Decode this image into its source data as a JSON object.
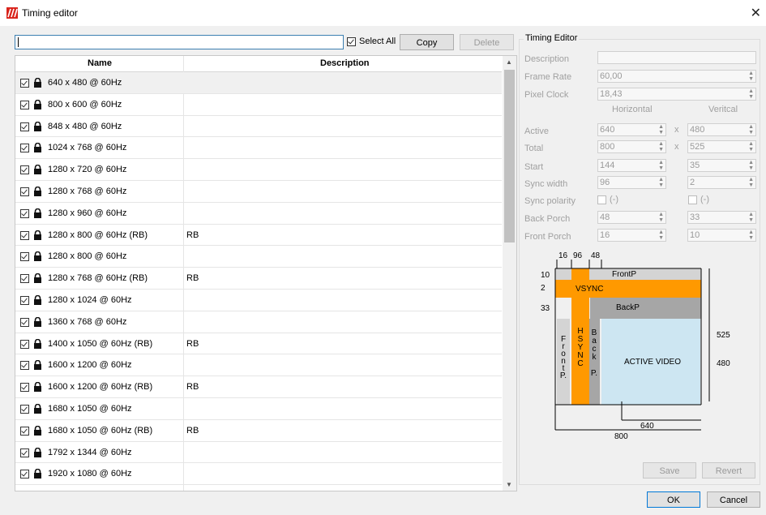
{
  "window": {
    "title": "Timing editor"
  },
  "toolbar": {
    "search_value": "",
    "select_all_label": "Select All",
    "select_all_checked": true,
    "copy_label": "Copy",
    "delete_label": "Delete"
  },
  "table": {
    "columns": [
      "Name",
      "Description"
    ],
    "rows": [
      {
        "name": "640 x 480 @ 60Hz",
        "desc": "",
        "checked": true,
        "locked": true,
        "selected": true
      },
      {
        "name": "800 x 600 @ 60Hz",
        "desc": "",
        "checked": true,
        "locked": true
      },
      {
        "name": "848 x 480 @ 60Hz",
        "desc": "",
        "checked": true,
        "locked": true
      },
      {
        "name": "1024 x 768 @ 60Hz",
        "desc": "",
        "checked": true,
        "locked": true
      },
      {
        "name": "1280 x 720 @ 60Hz",
        "desc": "",
        "checked": true,
        "locked": true
      },
      {
        "name": "1280 x 768 @ 60Hz",
        "desc": "",
        "checked": true,
        "locked": true
      },
      {
        "name": "1280 x 960 @ 60Hz",
        "desc": "",
        "checked": true,
        "locked": true
      },
      {
        "name": "1280 x 800 @ 60Hz (RB)",
        "desc": "RB",
        "checked": true,
        "locked": true
      },
      {
        "name": "1280 x 800 @ 60Hz",
        "desc": "",
        "checked": true,
        "locked": true
      },
      {
        "name": "1280 x 768 @ 60Hz (RB)",
        "desc": "RB",
        "checked": true,
        "locked": true
      },
      {
        "name": "1280 x 1024 @ 60Hz",
        "desc": "",
        "checked": true,
        "locked": true
      },
      {
        "name": "1360 x 768 @ 60Hz",
        "desc": "",
        "checked": true,
        "locked": true
      },
      {
        "name": "1400 x 1050 @ 60Hz (RB)",
        "desc": "RB",
        "checked": true,
        "locked": true
      },
      {
        "name": "1600 x 1200 @ 60Hz",
        "desc": "",
        "checked": true,
        "locked": true
      },
      {
        "name": "1600 x 1200 @ 60Hz (RB)",
        "desc": "RB",
        "checked": true,
        "locked": true
      },
      {
        "name": "1680 x 1050 @ 60Hz",
        "desc": "",
        "checked": true,
        "locked": true
      },
      {
        "name": "1680 x 1050 @ 60Hz (RB)",
        "desc": "RB",
        "checked": true,
        "locked": true
      },
      {
        "name": "1792 x 1344 @ 60Hz",
        "desc": "",
        "checked": true,
        "locked": true
      },
      {
        "name": "1920 x 1080 @ 60Hz",
        "desc": "",
        "checked": true,
        "locked": true
      }
    ]
  },
  "editor": {
    "group_title": "Timing Editor",
    "description_label": "Description",
    "description_value": "",
    "frame_rate_label": "Frame Rate",
    "frame_rate_value": "60,00",
    "pixel_clock_label": "Pixel Clock",
    "pixel_clock_value": "18,43",
    "horizontal_header": "Horizontal",
    "vertical_header": "Veritcal",
    "x_sep": "x",
    "active_label": "Active",
    "active_h": "640",
    "active_v": "480",
    "total_label": "Total",
    "total_h": "800",
    "total_v": "525",
    "start_label": "Start",
    "start_h": "144",
    "start_v": "35",
    "sync_width_label": "Sync width",
    "sync_width_h": "96",
    "sync_width_v": "2",
    "sync_polarity_label": "Sync polarity",
    "sync_polarity_h": "(-)",
    "sync_polarity_v": "(-)",
    "back_porch_label": "Back Porch",
    "back_porch_h": "48",
    "back_porch_v": "33",
    "front_porch_label": "Front Porch",
    "front_porch_h": "16",
    "front_porch_v": "10",
    "save_label": "Save",
    "revert_label": "Revert"
  },
  "diagram": {
    "h_front": "16",
    "h_sync": "96",
    "h_back": "48",
    "v_front": "10",
    "v_sync": "2",
    "v_back": "33",
    "frontp_label": "FrontP",
    "vsync_label": "VSYNC",
    "backp_label": "BackP",
    "hsync_letters": [
      "H",
      "S",
      "Y",
      "N",
      "C"
    ],
    "back_letters": [
      "B",
      "a",
      "c",
      "k",
      "",
      "P."
    ],
    "front_letters": [
      "F",
      "r",
      "o",
      "n",
      "t",
      "P."
    ],
    "active_label": "ACTIVE VIDEO",
    "h_active": "640",
    "h_total": "800",
    "v_active": "480",
    "v_total": "525",
    "colors": {
      "sync": "#ff9900",
      "porch": "#a6a6a6",
      "front": "#d4d4d4",
      "active": "#cde6f2"
    }
  },
  "dialog": {
    "ok_label": "OK",
    "cancel_label": "Cancel"
  }
}
